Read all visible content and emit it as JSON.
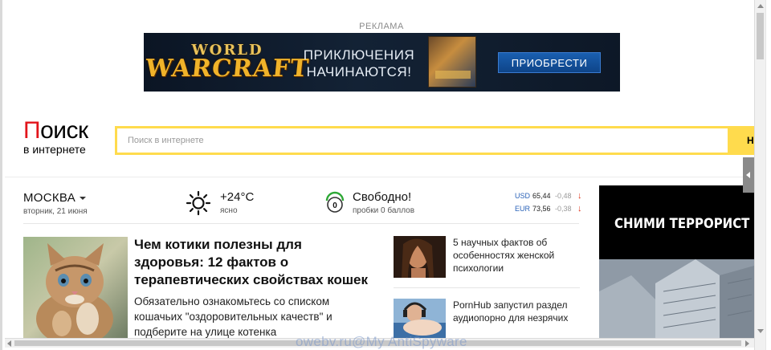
{
  "ad_top": {
    "label": "РЕКЛАМА",
    "logo_line1": "WORLD",
    "logo_line2": "WARCRAFT",
    "headline_line1": "ПРИКЛЮЧЕНИЯ",
    "headline_line2": "НАЧИНАЮТСЯ!",
    "button_label": "ПРИОБРЕСТИ",
    "button_color": "#0e4488"
  },
  "header": {
    "logo_first_letter": "П",
    "logo_rest": "оиск",
    "logo_sub": "в интернете",
    "logo_accent": "#e2141b",
    "search_placeholder": "Поиск в интернете",
    "search_value": "",
    "search_button_label": "Н",
    "search_accent": "#ffdb4d"
  },
  "info_bar": {
    "city": "МОСКВА",
    "date": "вторник, 21 июня",
    "weather_icon": "sun-icon",
    "temperature": "+24°С",
    "weather_desc": "ясно",
    "traffic_icon": "traffic-light-icon",
    "traffic_level": "0",
    "traffic_title": "Свободно!",
    "traffic_desc": "пробки 0 баллов",
    "rates": [
      {
        "code": "USD",
        "value": "65,44",
        "change": "-0,48",
        "arrow": "↓"
      },
      {
        "code": "EUR",
        "value": "73,56",
        "change": "-0,38",
        "arrow": "↓"
      }
    ]
  },
  "main_story": {
    "image_icon": "kitten-photo",
    "title": "Чем котики полезны для здоровья: 12 фактов о терапевтических свойствах кошек",
    "text": "Обязательно ознакомьтесь со списком кошачьих \"оздоровительных качеств\" и подберите на улице котенка"
  },
  "side_news": [
    {
      "image_icon": "woman-photo",
      "text": "5 научных фактов об особенностях женской психологии"
    },
    {
      "image_icon": "woman-headphones-photo",
      "text": "PornHub запустил раздел аудиопорно для незрячих"
    }
  ],
  "right_ad": {
    "text": "СНИМИ ТЕРРОРИСТ"
  },
  "watermark": "owebv.ru@My AntiSpyware"
}
